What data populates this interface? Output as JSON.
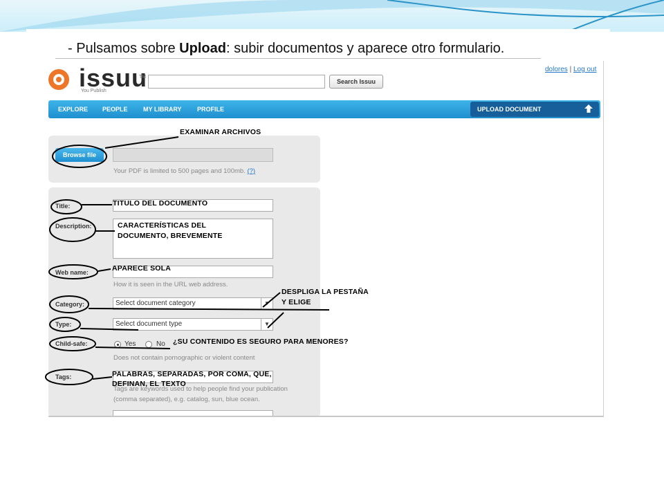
{
  "caption": {
    "prefix": "- Pulsamos sobre ",
    "bold": "Upload",
    "suffix": ": subir documentos y aparece otro formulario."
  },
  "header": {
    "logo": "issuu",
    "trademark": "TM",
    "tagline": "You Publish",
    "search_placeholder": "",
    "search_button": "Search Issuu",
    "user_link": "dolores",
    "separator": "|",
    "logout_link": "Log out"
  },
  "nav": {
    "items": [
      "EXPLORE",
      "PEOPLE",
      "MY LIBRARY",
      "PROFILE"
    ],
    "upload_label": "UPLOAD DOCUMENT",
    "upload_icon": "upload-arrow-icon"
  },
  "upload_form": {
    "browse_button": "Browse file",
    "limit_note": "Your PDF is limited to 500 pages and 100mb.",
    "help_link": "(?)",
    "labels": {
      "title": "Title:",
      "description": "Description:",
      "web_name": "Web name:",
      "category": "Category:",
      "type": "Type:",
      "child_safe": "Child-safe:",
      "tags": "Tags:"
    },
    "web_name_note": "How it is seen in the URL web address.",
    "category_value": "Select document category",
    "type_value": "Select document type",
    "child_safe_yes": "Yes",
    "child_safe_no": "No",
    "child_safe_note": "Does not contain pornographic or violent content",
    "tags_note_1": "Tags are keywords used to help people find your publication",
    "tags_note_2": "(comma separated), e.g. catalog, sun, blue ocean."
  },
  "annotations": {
    "examinar": "EXAMINAR ARCHIVOS",
    "titulo": "TITULO DEL DOCUMENTO",
    "caracteristicas_1": "CARACTERÍSTICAS DEL",
    "caracteristicas_2": "DOCUMENTO, BREVEMENTE",
    "aparece": "APARECE SOLA",
    "despliga_1": "DESPLIGA LA PESTAÑA",
    "despliga_2": "Y ELIGE",
    "seguro": "¿SU CONTENIDO ES SEGURO PARA MENORES?",
    "palabras_1": "PALABRAS, SEPARADAS, POR COMA, QUE,",
    "palabras_2": "DEFINAN, EL TEXTO"
  },
  "colors": {
    "accent_blue": "#1f8fcf",
    "logo_orange": "#ee7628",
    "link_blue": "#2277cc"
  }
}
